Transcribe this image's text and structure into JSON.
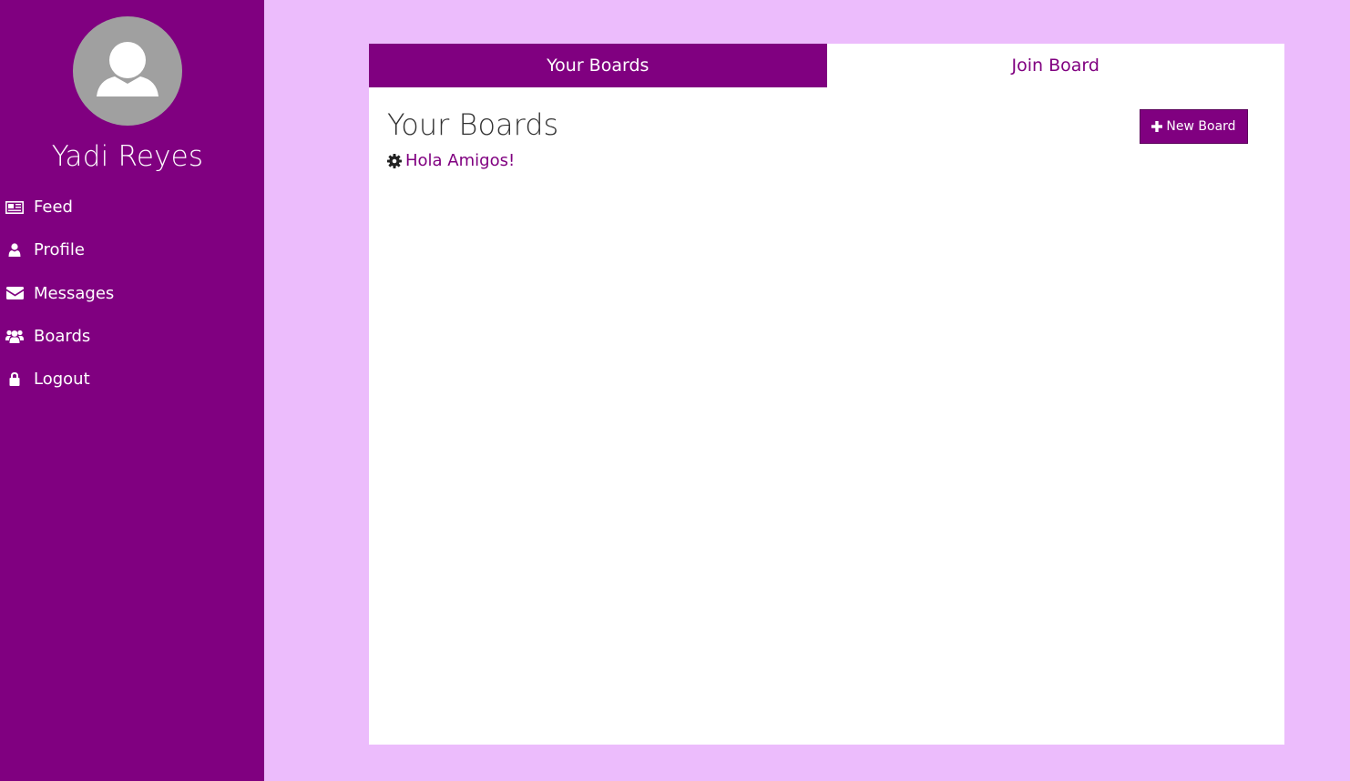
{
  "sidebar": {
    "user_name": "Yadi Reyes",
    "avatar_icon": "user-silhouette-icon",
    "items": [
      {
        "label": "Feed",
        "icon": "newspaper-icon"
      },
      {
        "label": "Profile",
        "icon": "user-icon"
      },
      {
        "label": "Messages",
        "icon": "envelope-icon"
      },
      {
        "label": "Boards",
        "icon": "users-icon"
      },
      {
        "label": "Logout",
        "icon": "lock-icon"
      }
    ]
  },
  "tabs": [
    {
      "label": "Your Boards",
      "active": true
    },
    {
      "label": "Join Board",
      "active": false
    }
  ],
  "main": {
    "title": "Your Boards",
    "new_board_label": "New Board",
    "boards": [
      {
        "name": "Hola Amigos!",
        "icon": "gear-icon"
      }
    ]
  },
  "colors": {
    "accent": "#800080",
    "background": "#ecbcfc",
    "panel": "#ffffff",
    "avatar_bg": "#a0a0a0"
  }
}
